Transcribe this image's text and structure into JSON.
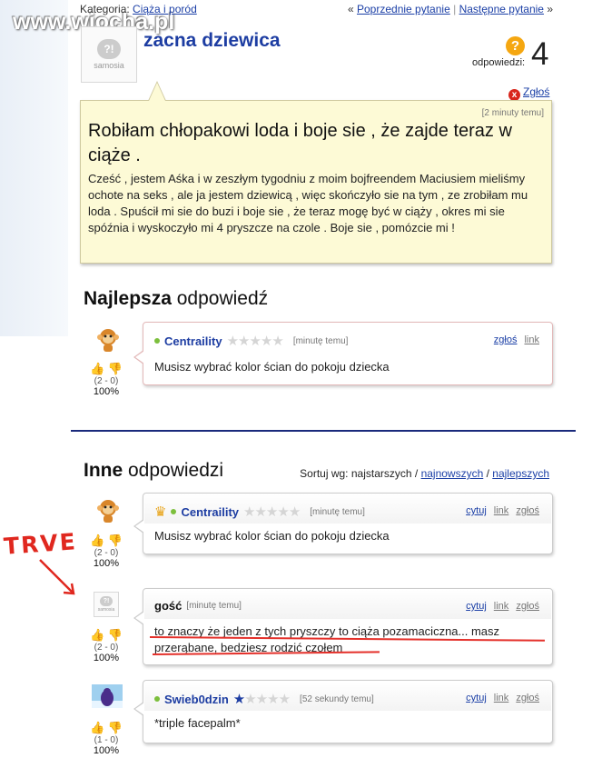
{
  "watermark": "www.wiocha.pl",
  "category": {
    "label": "Kategoria:",
    "link": "Ciąża i poród"
  },
  "nav": {
    "prev": "Poprzednie pytanie",
    "sep": "|",
    "next": "Następne pytanie",
    "prev_arrow": "«",
    "next_arrow": "»"
  },
  "logo": {
    "mark": "?!",
    "word": "samosia"
  },
  "question": {
    "title": "zacna dziewica",
    "icon": "?",
    "answers_label": "odpowiedzi:",
    "answers_count": "4",
    "report_icon": "x",
    "report_label": "Zgłoś",
    "timestamp": "[2 minuty temu]",
    "headline": "Robiłam chłopakowi loda i boje sie , że zajde teraz w ciąże .",
    "body": "Cześć , jestem Aśka i w zeszłym tygodniu z moim bojfreendem Maciusiem mieliśmy ochote na seks , ale ja jestem dziewicą , więc skończyło sie na tym , ze zrobiłam mu loda . Spuścił mi sie do buzi i boje sie , że teraz mogę być w ciąży , okres mi sie spóźnia i wyskoczyło mi 4 pryszcze na czole . Boje sie , pomózcie mi !"
  },
  "best": {
    "title_bold": "Najlepsza",
    "title_rest": " odpowiedź",
    "user": "Centraility",
    "stars": "★★★★★",
    "time": "[minutę temu]",
    "report": "zgłoś",
    "link": "link",
    "text": "Musisz wybrać kolor ścian do pokoju dziecka",
    "votes": "(2 - 0)",
    "pct": "100%"
  },
  "others": {
    "title_bold": "Inne",
    "title_rest": " odpowiedzi",
    "sort": {
      "label": "Sortuj wg: najstarszych /",
      "newest": "najnowszych",
      "slash": "/",
      "best": "najlepszych"
    }
  },
  "answers": [
    {
      "user": "Centraility",
      "crown": "♛",
      "stars_on": "",
      "stars_off": "★★★★★",
      "time": "[minutę temu]",
      "quote": "cytuj",
      "link": "link",
      "report": "zgłoś",
      "text": "Musisz wybrać kolor ścian do pokoju dziecka",
      "votes": "(2 - 0)",
      "pct": "100%"
    },
    {
      "user": "gość",
      "time": "[minutę temu]",
      "quote": "cytuj",
      "link": "link",
      "report": "zgłoś",
      "text": "to znaczy że jeden z tych pryszczy to ciąża pozamaciczna... masz przerąbane, bedziesz rodzić czołem",
      "votes": "(2 - 0)",
      "pct": "100%"
    },
    {
      "user": "Swieb0dzin",
      "stars_on": "★",
      "stars_off": "★★★★",
      "time": "[52 sekundy temu]",
      "quote": "cytuj",
      "link": "link",
      "report": "zgłoś",
      "text": "*triple facepalm*",
      "votes": "(1 - 0)",
      "pct": "100%"
    }
  ],
  "annotation": {
    "text": "TRVE",
    "color": "#e0281f"
  },
  "colors": {
    "link": "#1b3fa6",
    "username": "#1d3da2",
    "question_bg": "#fdfad6",
    "divider": "#1a2a7c"
  }
}
